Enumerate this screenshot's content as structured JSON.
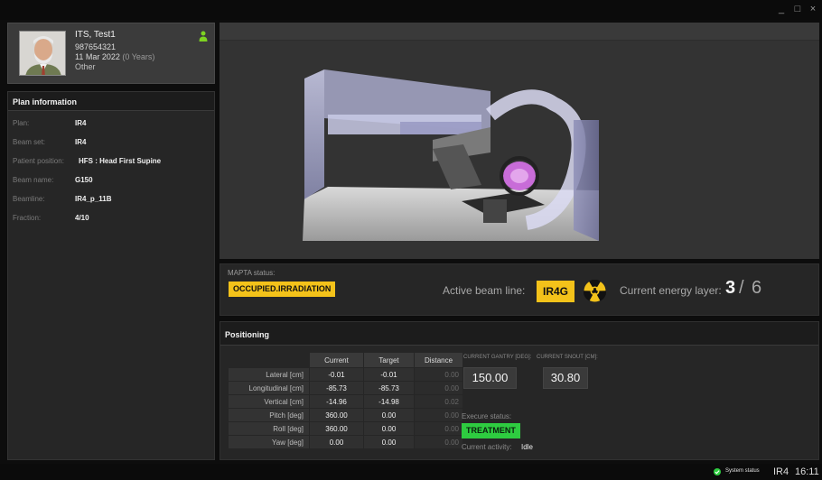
{
  "window": {
    "minimize": "_",
    "maximize": "□",
    "close": "×"
  },
  "patient": {
    "name": "ITS, Test1",
    "id": "987654321",
    "dob": "11 Mar 2022",
    "age": "(0 Years)",
    "sex": "Other",
    "status_color": "#7ed321"
  },
  "plan": {
    "header": "Plan information",
    "rows": [
      {
        "label": "Plan:",
        "value": "IR4"
      },
      {
        "label": "Beam set:",
        "value": "IR4"
      },
      {
        "label": "Patient position:",
        "value": "HFS : Head First Supine"
      },
      {
        "label": "Beam name:",
        "value": "G150"
      },
      {
        "label": "Beamline:",
        "value": "IR4_p_11B"
      },
      {
        "label": "Fraction:",
        "value": "4/10"
      }
    ]
  },
  "status": {
    "mapta_label": "MAPTA status:",
    "mapta_value": "OCCUPIED.IRRADIATION",
    "beam_line_label": "Active beam line:",
    "beam_line_value": "IR4G",
    "energy_label": "Current energy layer:",
    "energy_current": "3",
    "energy_separator": "/",
    "energy_total": "6",
    "warning_color": "#f3c21a"
  },
  "positioning": {
    "header": "Positioning",
    "columns": [
      "Current",
      "Target",
      "Distance"
    ],
    "rows": [
      {
        "label": "Lateral [cm]",
        "current": "-0.01",
        "target": "-0.01",
        "distance": "0.00"
      },
      {
        "label": "Longitudinal [cm]",
        "current": "-85.73",
        "target": "-85.73",
        "distance": "0.00"
      },
      {
        "label": "Vertical [cm]",
        "current": "-14.96",
        "target": "-14.98",
        "distance": "0.02"
      },
      {
        "label": "Pitch [deg]",
        "current": "360.00",
        "target": "0.00",
        "distance": "0.00"
      },
      {
        "label": "Roll [deg]",
        "current": "360.00",
        "target": "0.00",
        "distance": "0.00"
      },
      {
        "label": "Yaw [deg]",
        "current": "0.00",
        "target": "0.00",
        "distance": "0.00"
      }
    ],
    "gantry_label": "CURRENT GANTRY [DEG]:",
    "gantry_value": "150.00",
    "snout_label": "CURRENT SNOUT [CM]:",
    "snout_value": "30.80",
    "exec_label": "Execure status:",
    "exec_value": "TREATMENT",
    "activity_label": "Current activity:",
    "activity_value": "Idle",
    "ok_color": "#2ecc40"
  },
  "footer": {
    "system_status": "System status",
    "room": "IR4",
    "time": "16:11"
  }
}
